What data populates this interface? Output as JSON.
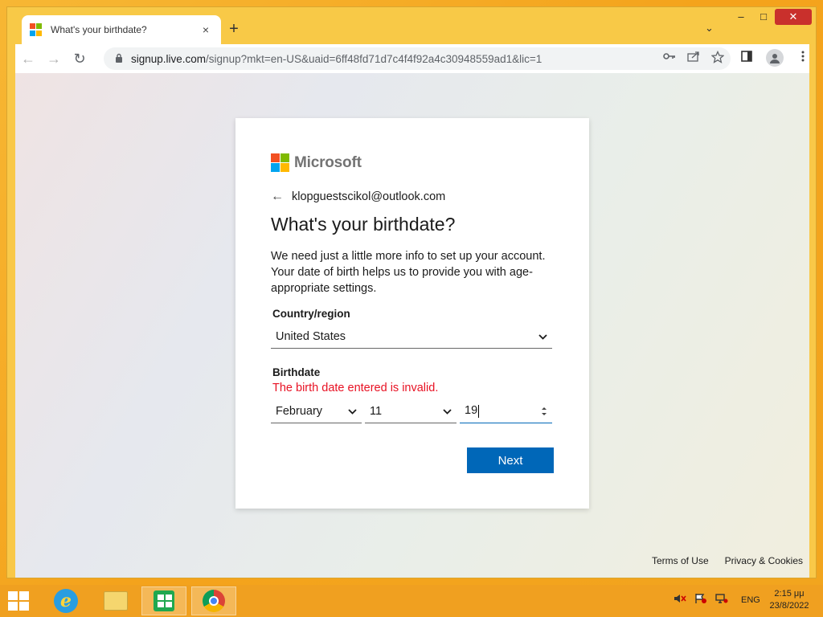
{
  "browser": {
    "tab_title": "What's your birthdate?",
    "tab_close": "×",
    "new_tab": "+",
    "tab_dropdown": "⌄",
    "window_controls": {
      "minimize": "–",
      "maximize": "□",
      "close": "✕"
    },
    "nav": {
      "back": "←",
      "forward": "→",
      "reload": "↻"
    },
    "url_host": "signup.live.com",
    "url_path": "/signup?mkt=en-US&uaid=6ff48fd71d7c4f4f92a4c30948559ad1&lic=1",
    "omnibox_icons": [
      "key-icon",
      "share-icon",
      "star-icon"
    ],
    "toolbar_icons": [
      "sidepanel-icon",
      "profile-icon",
      "menu-icon"
    ]
  },
  "brand": {
    "name": "Microsoft",
    "colors": [
      "#f25022",
      "#7fba00",
      "#00a4ef",
      "#ffb900"
    ]
  },
  "signup": {
    "email": "klopguestscikol@outlook.com",
    "heading": "What's your birthdate?",
    "description": "We need just a little more info to set up your account. Your date of birth helps us to provide you with age-appropriate settings.",
    "country_label": "Country/region",
    "country_value": "United States",
    "birthdate_label": "Birthdate",
    "error": "The birth date entered is invalid.",
    "month": "February",
    "day": "11",
    "year": "19",
    "next_label": "Next",
    "accent_color": "#0067b8",
    "error_color": "#e81123"
  },
  "footer": {
    "terms": "Terms of Use",
    "privacy": "Privacy & Cookies"
  },
  "taskbar": {
    "apps": [
      "start-icon",
      "internet-explorer-icon",
      "file-explorer-icon",
      "store-icon",
      "chrome-icon"
    ],
    "tray_icons": [
      "volume-muted-icon",
      "flag-icon",
      "network-icon"
    ],
    "language": "ENG",
    "time": "2:15 μμ",
    "date": "23/8/2022"
  }
}
